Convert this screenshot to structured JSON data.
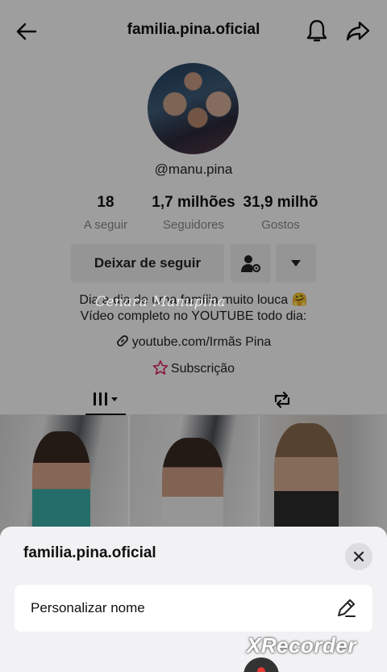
{
  "header": {
    "title": "familia.pina.oficial"
  },
  "profile": {
    "handle": "@manu.pina",
    "stats": [
      {
        "value": "18",
        "label": "A seguir"
      },
      {
        "value": "1,7 milhões",
        "label": "Seguidores"
      },
      {
        "value": "31,9 milhõ",
        "label": "Gostos"
      }
    ],
    "buttons": {
      "unfollow": "Deixar de seguir"
    },
    "bio_line1": "Dia a dia de uma família muito louca 🤗",
    "bio_line2": "Vídeo completo no YOUTUBE todo dia:",
    "link": "youtube.com/Irmãs Pina",
    "subscription": "Subscrição"
  },
  "watermark": "Cenara Manupina",
  "sheet": {
    "title": "familia.pina.oficial",
    "item_label": "Personalizar nome"
  },
  "recorder": {
    "label": "XRecorder"
  },
  "colors": {
    "sheet_bg": "#f2f2f4",
    "text": "#111111",
    "muted": "#8a8a8a",
    "button_bg": "#f1f1f2"
  }
}
